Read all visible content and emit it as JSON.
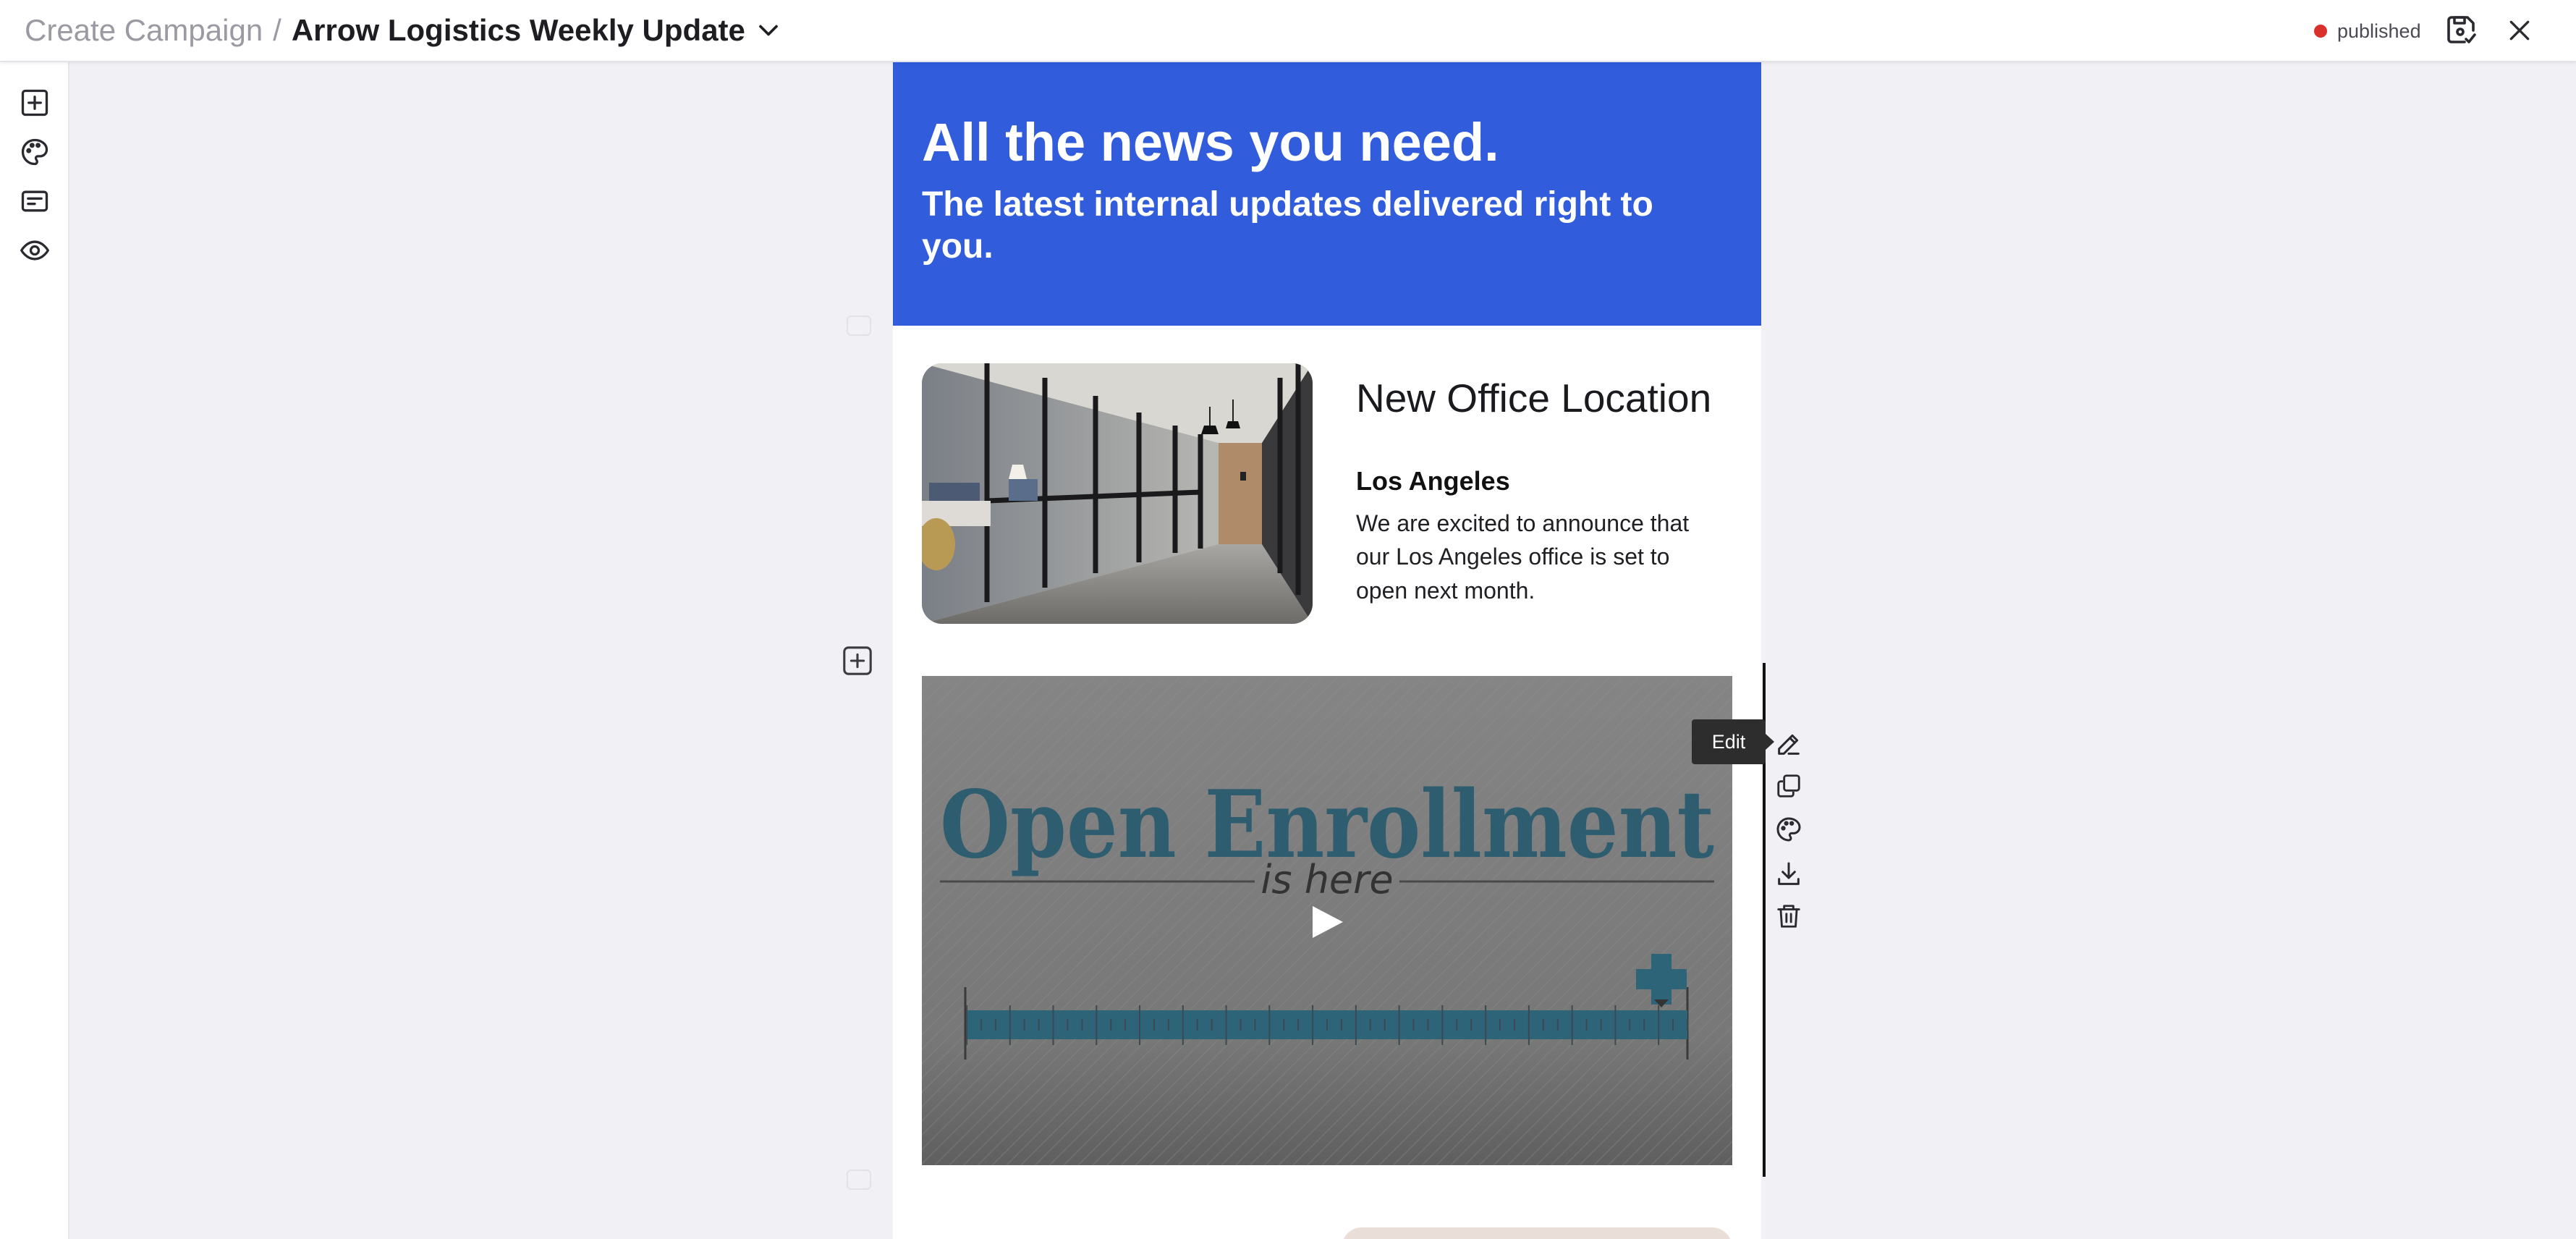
{
  "header": {
    "breadcrumb_root": "Create Campaign",
    "separator": "/",
    "campaign_title": "Arrow Logistics Weekly Update",
    "status_label": "published",
    "status_color": "#d9302b",
    "save_icon": "save-check-icon",
    "close_icon": "close-icon"
  },
  "left_rail": {
    "items": [
      {
        "icon": "add-block-icon"
      },
      {
        "icon": "palette-icon"
      },
      {
        "icon": "form-icon"
      },
      {
        "icon": "eye-icon"
      }
    ]
  },
  "email": {
    "hero": {
      "title": "All the news you need.",
      "subtitle": "The latest internal updates delivered right to you.",
      "background_color": "#315cdc"
    },
    "article": {
      "title": "New Office Location",
      "subtitle": "Los Angeles",
      "body": "We are excited to announce that our Los Angeles office is set to open next month."
    },
    "video": {
      "headline": "Open Enrollment",
      "tagline": "is here"
    }
  },
  "block_toolbar": {
    "tooltip": "Edit",
    "tools": [
      "edit-icon",
      "duplicate-icon",
      "palette-icon",
      "download-icon",
      "delete-icon"
    ]
  }
}
